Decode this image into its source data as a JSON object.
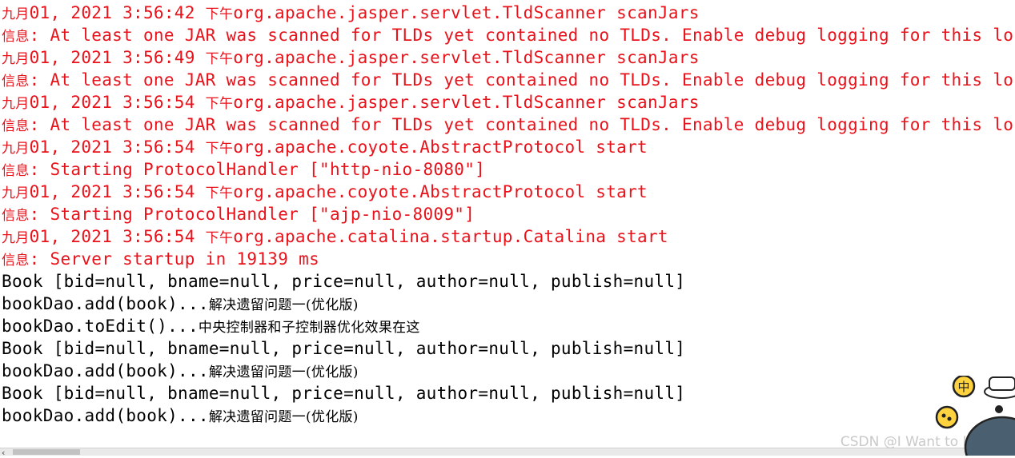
{
  "console": {
    "lines": [
      {
        "kind": "err",
        "parts": [
          {
            "t": "九月",
            "cjk": true
          },
          {
            "t": "01, 2021 3:56:42 "
          },
          {
            "t": "下午",
            "cjk": true
          },
          {
            "t": "org.apache.jasper.servlet.TldScanner scanJars"
          }
        ]
      },
      {
        "kind": "err",
        "parts": [
          {
            "t": "信息",
            "cjk": true
          },
          {
            "t": ": At least one JAR was scanned for TLDs yet contained no TLDs. Enable debug logging for this lo"
          }
        ]
      },
      {
        "kind": "err",
        "parts": [
          {
            "t": "九月",
            "cjk": true
          },
          {
            "t": "01, 2021 3:56:49 "
          },
          {
            "t": "下午",
            "cjk": true
          },
          {
            "t": "org.apache.jasper.servlet.TldScanner scanJars"
          }
        ]
      },
      {
        "kind": "err",
        "parts": [
          {
            "t": "信息",
            "cjk": true
          },
          {
            "t": ": At least one JAR was scanned for TLDs yet contained no TLDs. Enable debug logging for this lo"
          }
        ]
      },
      {
        "kind": "err",
        "parts": [
          {
            "t": "九月",
            "cjk": true
          },
          {
            "t": "01, 2021 3:56:54 "
          },
          {
            "t": "下午",
            "cjk": true
          },
          {
            "t": "org.apache.jasper.servlet.TldScanner scanJars"
          }
        ]
      },
      {
        "kind": "err",
        "parts": [
          {
            "t": "信息",
            "cjk": true
          },
          {
            "t": ": At least one JAR was scanned for TLDs yet contained no TLDs. Enable debug logging for this lo"
          }
        ]
      },
      {
        "kind": "err",
        "parts": [
          {
            "t": "九月",
            "cjk": true
          },
          {
            "t": "01, 2021 3:56:54 "
          },
          {
            "t": "下午",
            "cjk": true
          },
          {
            "t": "org.apache.coyote.AbstractProtocol start"
          }
        ]
      },
      {
        "kind": "err",
        "parts": [
          {
            "t": "信息",
            "cjk": true
          },
          {
            "t": ": Starting ProtocolHandler [\"http-nio-8080\"]"
          }
        ]
      },
      {
        "kind": "err",
        "parts": [
          {
            "t": "九月",
            "cjk": true
          },
          {
            "t": "01, 2021 3:56:54 "
          },
          {
            "t": "下午",
            "cjk": true
          },
          {
            "t": "org.apache.coyote.AbstractProtocol start"
          }
        ]
      },
      {
        "kind": "err",
        "parts": [
          {
            "t": "信息",
            "cjk": true
          },
          {
            "t": ": Starting ProtocolHandler [\"ajp-nio-8009\"]"
          }
        ]
      },
      {
        "kind": "err",
        "parts": [
          {
            "t": "九月",
            "cjk": true
          },
          {
            "t": "01, 2021 3:56:54 "
          },
          {
            "t": "下午",
            "cjk": true
          },
          {
            "t": "org.apache.catalina.startup.Catalina start"
          }
        ]
      },
      {
        "kind": "err",
        "parts": [
          {
            "t": "信息",
            "cjk": true
          },
          {
            "t": ": Server startup in 19139 ms"
          }
        ]
      },
      {
        "kind": "out",
        "parts": [
          {
            "t": "Book [bid=null, bname=null, price=null, author=null, publish=null]"
          }
        ]
      },
      {
        "kind": "out",
        "parts": [
          {
            "t": "bookDao.add(book)..."
          },
          {
            "t": "解决遗留问题一(优化版)",
            "cjk": true
          }
        ]
      },
      {
        "kind": "out",
        "parts": [
          {
            "t": "bookDao.toEdit()..."
          },
          {
            "t": "中央控制器和子控制器优化效果在这",
            "cjk": true
          }
        ]
      },
      {
        "kind": "out",
        "parts": [
          {
            "t": "Book [bid=null, bname=null, price=null, author=null, publish=null]"
          }
        ]
      },
      {
        "kind": "out",
        "parts": [
          {
            "t": "bookDao.add(book)..."
          },
          {
            "t": "解决遗留问题一(优化版)",
            "cjk": true
          }
        ]
      },
      {
        "kind": "out",
        "parts": [
          {
            "t": "Book [bid=null, bname=null, price=null, author=null, publish=null]"
          }
        ]
      },
      {
        "kind": "out",
        "parts": [
          {
            "t": "bookDao.add(book)..."
          },
          {
            "t": "解决遗留问题一(优化版)",
            "cjk": true
          }
        ]
      }
    ],
    "colors": {
      "err": "#e8121b",
      "out": "#000000"
    }
  },
  "scrollbar": {
    "left_arrow": "‹"
  },
  "watermark": "CSDN @I Want to IT大师",
  "mascot": {
    "badge_text": "中",
    "icon": "mascot-icon"
  }
}
